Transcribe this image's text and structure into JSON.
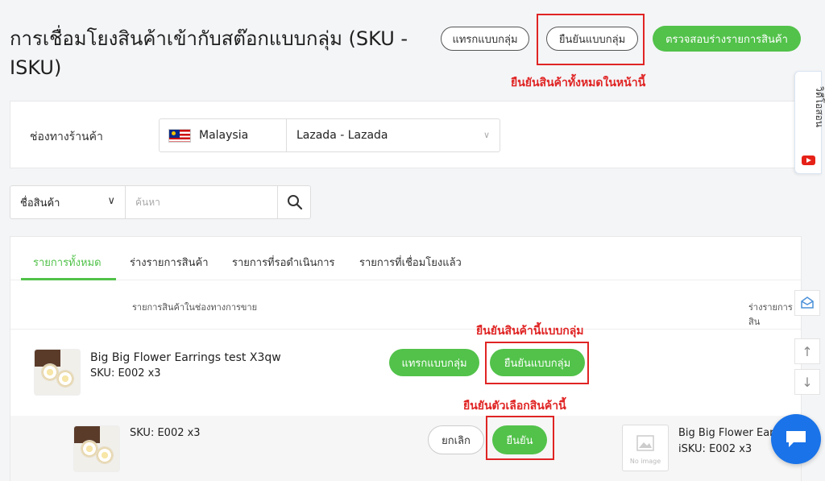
{
  "header": {
    "title": "การเชื่อมโยงสินค้าเข้ากับสต๊อกแบบกลุ่ม (SKU - ISKU)",
    "insert_bulk_label": "แทรกแบบกลุ่ม",
    "confirm_bulk_label": "ยืนยันแบบกลุ่ม",
    "check_draft_label": "ตรวจสอบร่างรายการสินค้า"
  },
  "annotations": {
    "confirm_all_note": "ยืนยันสินค้าทั้งหมดในหน้านี้",
    "confirm_bulk_item_note": "ยืนยันสินค้านี้แบบกลุ่ม",
    "confirm_variant_note": "ยืนยันตัวเลือกสินค้านี้",
    "highlight_color": "#e02424"
  },
  "channel": {
    "label": "ช่องทางร้านค้า",
    "country": "Malaysia",
    "shop": "Lazada - Lazada"
  },
  "search": {
    "type_label": "ชื่อสินค้า",
    "placeholder": "ค้นหา",
    "value": ""
  },
  "tabs": [
    {
      "label": "รายการทั้งหมด",
      "active": true
    },
    {
      "label": "ร่างรายการสินค้า",
      "active": false
    },
    {
      "label": "รายการที่รอดำเนินการ",
      "active": false
    },
    {
      "label": "รายการที่เชื่อมโยงแล้ว",
      "active": false
    }
  ],
  "columns": {
    "channel_items": "รายการสินค้าในช่องทางการขาย",
    "draft_items": "ร่างรายการสิน"
  },
  "product": {
    "name": "Big Big Flower Earrings test X3qw",
    "sku": "SKU: E002 x3",
    "insert_bulk_label": "แทรกแบบกลุ่ม",
    "confirm_bulk_label": "ยืนยันแบบกลุ่ม"
  },
  "variant": {
    "sku": "SKU: E002 x3",
    "cancel_label": "ยกเลิก",
    "confirm_label": "ยืนยัน",
    "linked_name": "Big Big Flower Ear",
    "linked_isku": "iSKU: E002 x3",
    "no_image_label": "No image"
  },
  "side": {
    "video_label": "วิดีโอสอน"
  },
  "colors": {
    "accent_green": "#52c24a",
    "chat_blue": "#1a73e8"
  }
}
